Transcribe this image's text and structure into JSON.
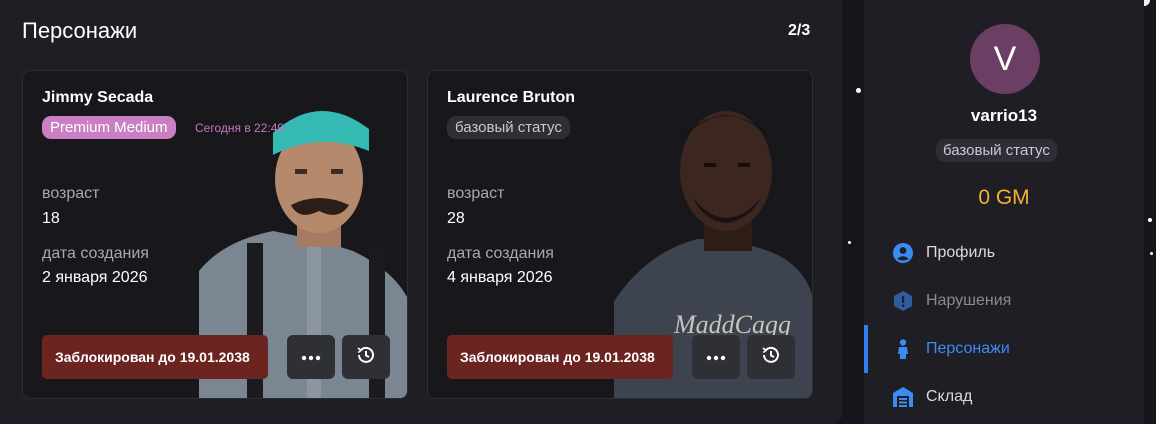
{
  "main": {
    "title": "Персонажи",
    "page_count": "2/3"
  },
  "characters": [
    {
      "name": "Jimmy Secada",
      "status_badge": "Premium Medium",
      "status_time": "Сегодня в 22:49",
      "age_label": "возраст",
      "age_value": "18",
      "created_label": "дата создания",
      "created_value": "2 января 2026",
      "blocked_text": "Заблокирован до 19.01.2038",
      "more_icon": "more-dots-icon",
      "history_icon": "history-clock-icon"
    },
    {
      "name": "Laurence Bruton",
      "status_badge": "базовый статус",
      "age_label": "возраст",
      "age_value": "28",
      "created_label": "дата создания",
      "created_value": "4 января 2026",
      "blocked_text": "Заблокирован до 19.01.2038",
      "more_icon": "more-dots-icon",
      "history_icon": "history-clock-icon"
    }
  ],
  "profile": {
    "avatar_letter": "V",
    "avatar_color": "#6b3e63",
    "username": "varrio13",
    "status_badge": "базовый статус",
    "balance": "0 GM",
    "balance_color": "#f0b233"
  },
  "nav": {
    "items": [
      {
        "label": "Профиль",
        "icon": "user-circle-icon"
      },
      {
        "label": "Нарушения",
        "icon": "warning-hexagon-icon"
      },
      {
        "label": "Персонажи",
        "icon": "person-icon",
        "active": true
      },
      {
        "label": "Склад",
        "icon": "warehouse-icon"
      }
    ],
    "accent_color": "#2f7ff0"
  }
}
